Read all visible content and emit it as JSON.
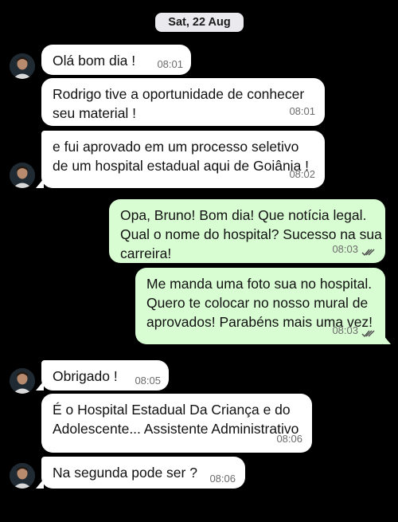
{
  "date_separator": "Sat, 22 Aug",
  "messages": [
    {
      "text": "Olá bom dia !",
      "time": "08:01"
    },
    {
      "text": "Rodrigo tive a oportunidade de conhecer\nseu material !",
      "time": "08:01"
    },
    {
      "text": "e fui aprovado em um processo seletivo\nde um hospital estadual aqui de Goiânia !",
      "time": "08:02"
    },
    {
      "text": "Opa, Bruno! Bom dia! Que notícia legal.\nQual o nome do hospital? Sucesso na sua\ncarreira!",
      "time": "08:03",
      "status": "read"
    },
    {
      "text": "Me manda uma foto sua no hospital.\nQuero te colocar no nosso mural de\naprovados! Parabéns mais uma vez!",
      "time": "08:03",
      "status": "read"
    },
    {
      "text": "Obrigado !",
      "time": "08:05"
    },
    {
      "text": "É o Hospital Estadual Da Criança e do\nAdolescente... Assistente Administrativo",
      "time": "08:06"
    },
    {
      "text": "Na segunda pode ser ?",
      "time": "08:06"
    }
  ],
  "colors": {
    "background": "#000000",
    "incoming_bubble": "#ffffff",
    "outgoing_bubble": "#d9fdd3",
    "read_ticks": "#4a4a4a"
  }
}
